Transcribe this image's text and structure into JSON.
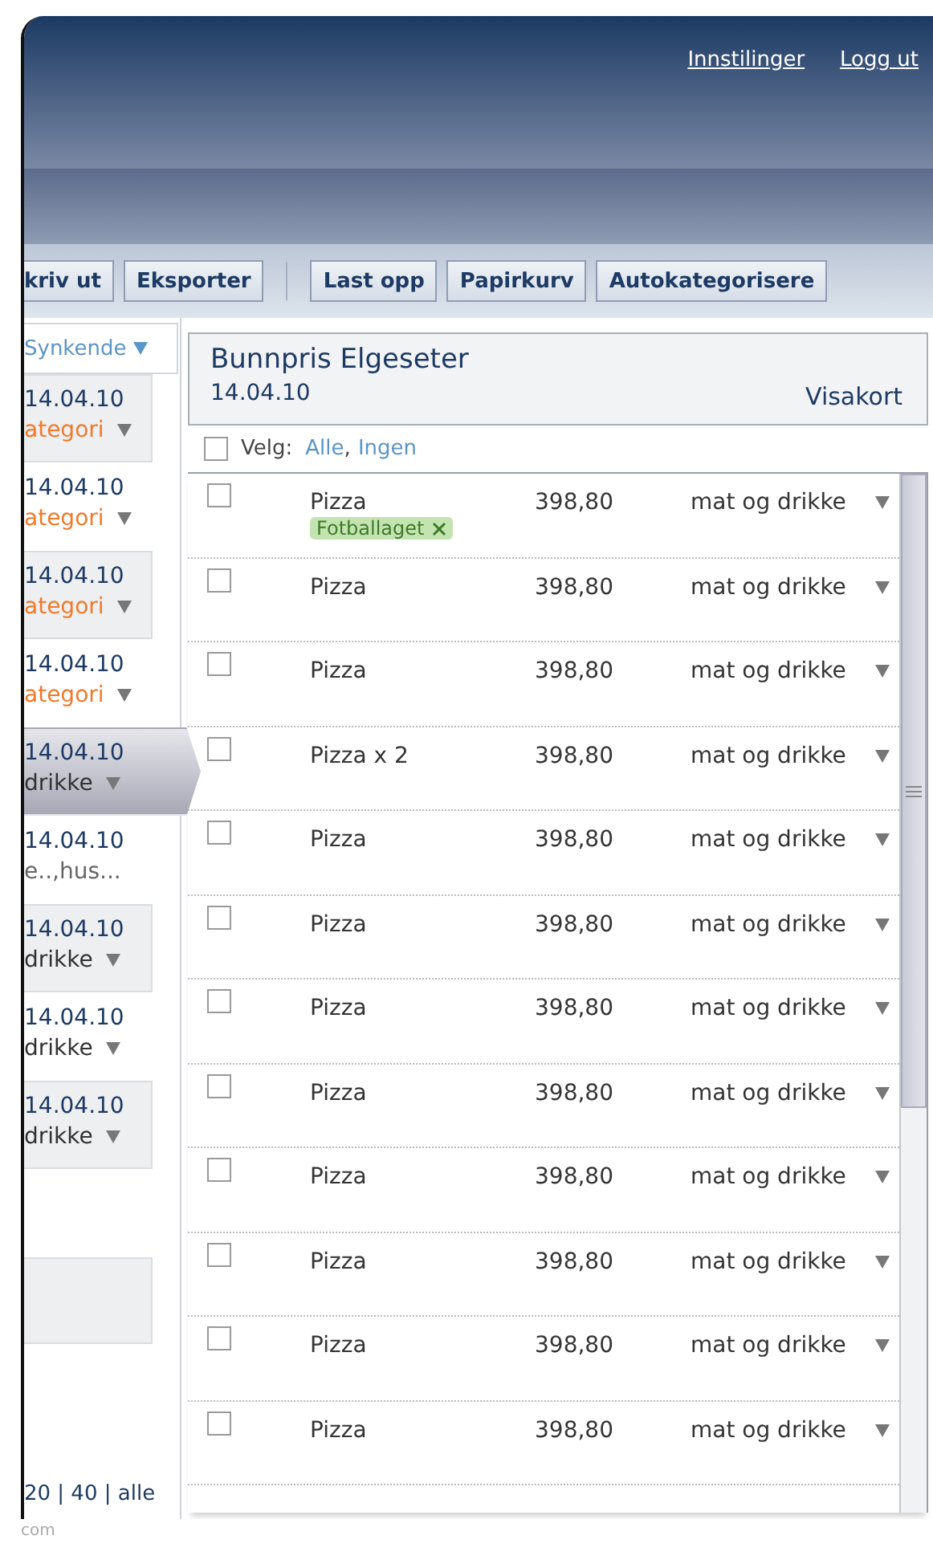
{
  "header": {
    "links": [
      "Innstilinger",
      "Logg ut"
    ]
  },
  "toolbar": {
    "groups": [
      [
        "kriv ut",
        "Eksporter"
      ],
      [
        "Last opp",
        "Papirkurv",
        "Autokategorisere"
      ]
    ]
  },
  "sidebar": {
    "sort": "Synkende",
    "items": [
      {
        "date": "14.04.10",
        "category": "ategori",
        "kind": "uncategorized",
        "selected": false
      },
      {
        "date": "14.04.10",
        "category": "ategori",
        "kind": "uncategorized",
        "selected": false
      },
      {
        "date": "14.04.10",
        "category": "ategori",
        "kind": "uncategorized",
        "selected": false
      },
      {
        "date": "14.04.10",
        "category": "ategori",
        "kind": "uncategorized",
        "selected": false
      },
      {
        "date": "14.04.10",
        "category": "drikke",
        "kind": "category",
        "selected": true
      },
      {
        "date": "14.04.10",
        "category": "e..,hus...",
        "kind": "tags",
        "selected": false
      },
      {
        "date": "14.04.10",
        "category": "drikke",
        "kind": "category",
        "selected": false
      },
      {
        "date": "14.04.10",
        "category": "drikke",
        "kind": "category",
        "selected": false
      },
      {
        "date": "14.04.10",
        "category": "drikke",
        "kind": "category",
        "selected": false
      }
    ],
    "pager": "20 | 40 | alle"
  },
  "receipt": {
    "store": "Bunnpris Elgeseter",
    "date": "14.04.10",
    "payment": "Visakort",
    "select": {
      "label": "Velg:",
      "links": [
        "Alle",
        "Ingen"
      ],
      "separator": ",",
      "checked": false
    },
    "rows": [
      {
        "name": "Pizza",
        "amount": "398,80",
        "category": "mat og drikke",
        "checked": false,
        "tags": [
          "Fotballaget"
        ]
      },
      {
        "name": "Pizza",
        "amount": "398,80",
        "category": "mat og drikke",
        "checked": false
      },
      {
        "name": "Pizza",
        "amount": "398,80",
        "category": "mat og drikke",
        "checked": false
      },
      {
        "name": "Pizza x 2",
        "amount": "398,80",
        "category": "mat og drikke",
        "checked": false
      },
      {
        "name": "Pizza",
        "amount": "398,80",
        "category": "mat og drikke",
        "checked": false
      },
      {
        "name": "Pizza",
        "amount": "398,80",
        "category": "mat og drikke",
        "checked": false
      },
      {
        "name": "Pizza",
        "amount": "398,80",
        "category": "mat og drikke",
        "checked": false
      },
      {
        "name": "Pizza",
        "amount": "398,80",
        "category": "mat og drikke",
        "checked": false
      },
      {
        "name": "Pizza",
        "amount": "398,80",
        "category": "mat og drikke",
        "checked": false
      },
      {
        "name": "Pizza",
        "amount": "398,80",
        "category": "mat og drikke",
        "checked": false
      },
      {
        "name": "Pizza",
        "amount": "398,80",
        "category": "mat og drikke",
        "checked": false
      },
      {
        "name": "Pizza",
        "amount": "398,80",
        "category": "mat og drikke",
        "checked": false
      }
    ]
  },
  "footer": {
    "text": "com"
  }
}
